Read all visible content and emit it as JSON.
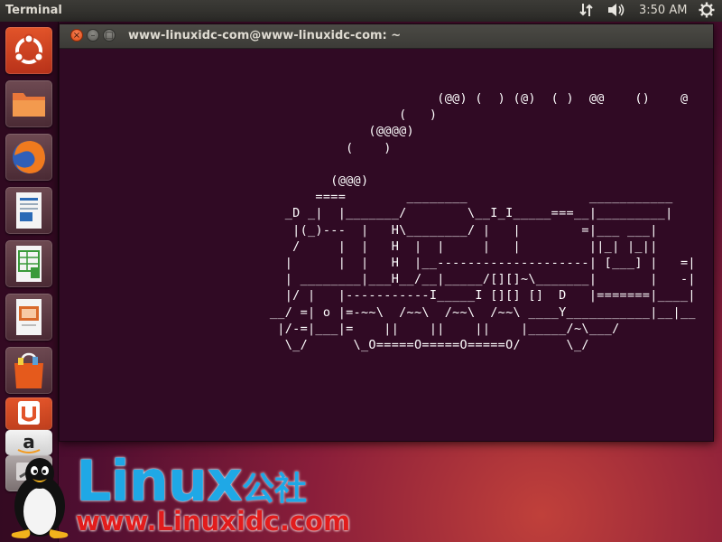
{
  "top_panel": {
    "app_title": "Terminal",
    "clock": "3:50 AM",
    "indicators": [
      "network-icon",
      "volume-icon",
      "power-gear-icon"
    ]
  },
  "launcher": {
    "items": [
      {
        "name": "ubuntu-dash",
        "icon": "ubuntu-logo-icon"
      },
      {
        "name": "files",
        "icon": "folder-icon"
      },
      {
        "name": "firefox",
        "icon": "firefox-icon"
      },
      {
        "name": "libreoffice-writer",
        "icon": "writer-document-icon"
      },
      {
        "name": "libreoffice-calc",
        "icon": "calc-spreadsheet-icon"
      },
      {
        "name": "libreoffice-impress",
        "icon": "impress-presentation-icon"
      },
      {
        "name": "software-center",
        "icon": "shopping-bag-icon"
      },
      {
        "name": "ubuntu-one",
        "icon": "ubuntu-one-icon"
      },
      {
        "name": "amazon",
        "icon": "amazon-icon"
      },
      {
        "name": "system-settings",
        "icon": "settings-icon"
      }
    ]
  },
  "terminal": {
    "window_title": "www-linuxidc-com@www-linuxidc-com: ~",
    "buttons": {
      "close": "×",
      "minimize": "–",
      "maximize": "□"
    },
    "output": "                        (@@) (  ) (@)  ( )  @@    ()    @\n                   (   )\n               (@@@@)\n            (    )\n\n          (@@@)\n        ====        ________                ___________\n    _D _|  |_______/        \\__I_I_____===__|_________|\n     |(_)---  |   H\\________/ |   |        =|___ ___|\n     /     |  |   H  |  |     |   |         ||_| |_||\n    |      |  |   H  |__--------------------| [___] |   =|\n    | ________|___H__/__|_____/[][]~\\_______|       |   -|\n    |/ |   |-----------I_____I [][] []  D   |=======|____|\n  __/ =| o |=-~~\\  /~~\\  /~~\\  /~~\\ ____Y___________|__|__\n   |/-=|___|=    ||    ||    ||    |_____/~\\___/\n    \\_/      \\_O=====O=====O=====O/      \\_/"
  },
  "watermark": {
    "brand": "Linux",
    "brand_cn": "公社",
    "url": "www.Linuxidc.com"
  }
}
